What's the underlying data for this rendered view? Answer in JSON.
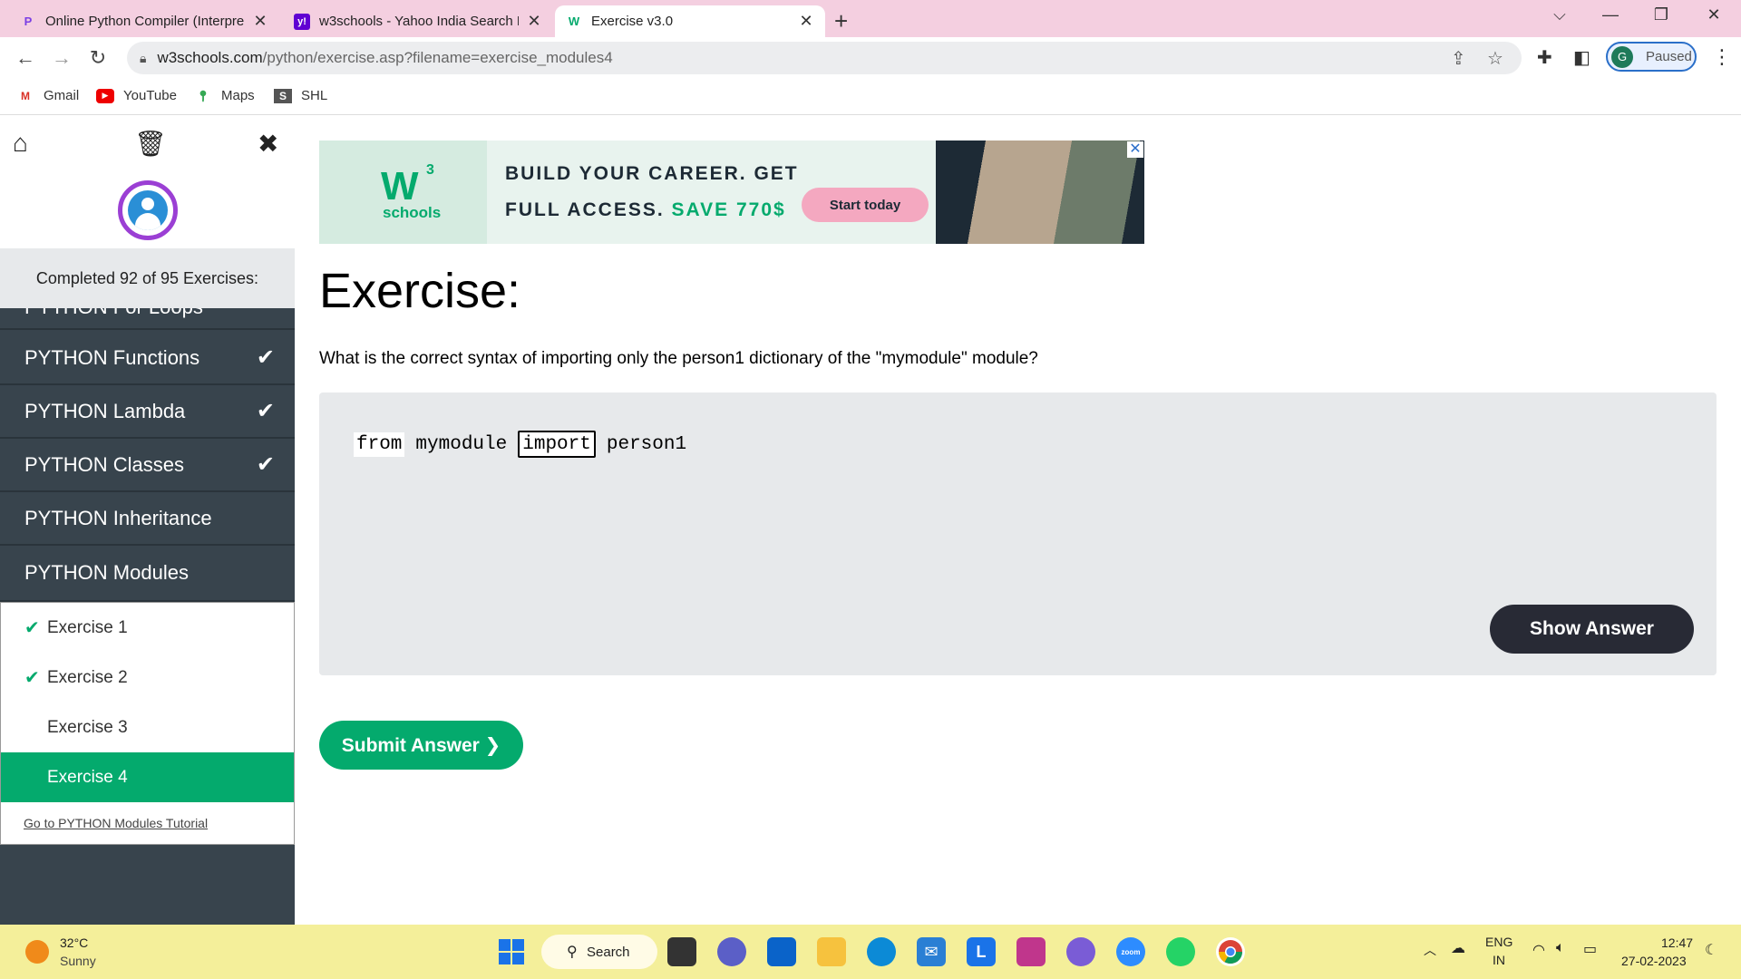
{
  "browser": {
    "tabs": [
      {
        "title": "Online Python Compiler (Interpre",
        "favicon": "P",
        "favicon_color": "#7b3fe4"
      },
      {
        "title": "w3schools - Yahoo India Search R",
        "favicon": "y!",
        "favicon_color": "#6001d2"
      },
      {
        "title": "Exercise v3.0",
        "favicon": "W",
        "favicon_color": "#04aa6d"
      }
    ],
    "url_host": "w3schools.com",
    "url_path": "/python/exercise.asp?filename=exercise_modules4",
    "profile_initial": "G",
    "profile_status": "Paused",
    "bookmarks": [
      {
        "label": "Gmail",
        "icon": "gmail-icon"
      },
      {
        "label": "YouTube",
        "icon": "youtube-icon"
      },
      {
        "label": "Maps",
        "icon": "maps-icon"
      },
      {
        "label": "SHL",
        "icon": "shl-icon"
      }
    ]
  },
  "sidebar": {
    "completed_text": "Completed 92 of 95 Exercises:",
    "partial_item": "PYTHON For Loops",
    "items": [
      {
        "label": "PYTHON Functions",
        "done": true
      },
      {
        "label": "PYTHON Lambda",
        "done": true
      },
      {
        "label": "PYTHON Classes",
        "done": true
      },
      {
        "label": "PYTHON Inheritance",
        "done": false
      },
      {
        "label": "PYTHON Modules",
        "done": false
      }
    ],
    "exercises": [
      {
        "label": "Exercise 1",
        "done": true
      },
      {
        "label": "Exercise 2",
        "done": true
      },
      {
        "label": "Exercise 3",
        "done": false
      },
      {
        "label": "Exercise 4",
        "done": false,
        "current": true
      }
    ],
    "tutorial_link": "Go to PYTHON Modules Tutorial"
  },
  "ad": {
    "logo_w": "W",
    "logo_sup": "3",
    "logo_text": "schools",
    "line1": "BUILD YOUR CAREER. GET",
    "line2": "FULL ACCESS.",
    "line2_save": "SAVE 770$",
    "cta": "Start today"
  },
  "main": {
    "title": "Exercise:",
    "question": "What is the correct syntax of importing only the person1 dictionary of the \"mymodule\" module?",
    "code_kw1": "from",
    "code_mod": "mymodule",
    "code_input": "import",
    "code_tail": "person1",
    "show_answer": "Show Answer",
    "submit": "Submit Answer ❯"
  },
  "taskbar": {
    "temp": "32°C",
    "weather": "Sunny",
    "search": "Search",
    "lang1": "ENG",
    "lang2": "IN",
    "time": "12:47",
    "date": "27-02-2023"
  },
  "colors": {
    "accent_green": "#04aa6d",
    "sidebar_dark": "#38444d",
    "tabstrip_pink": "#f4cfe0",
    "taskbar_yellow": "#f4ef9a"
  }
}
